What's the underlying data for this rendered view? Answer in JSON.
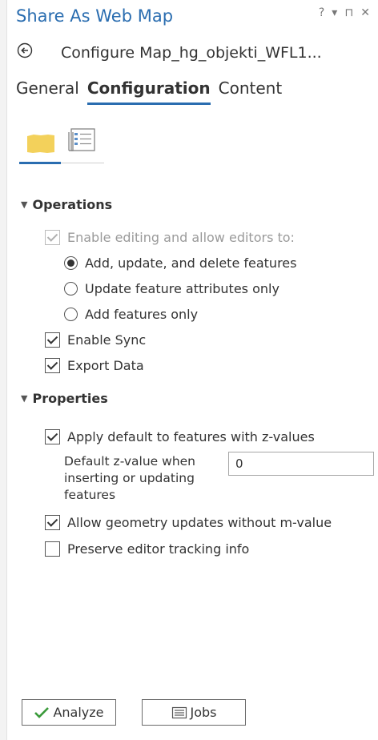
{
  "window": {
    "title": "Share As Web Map",
    "controls": {
      "help": "?",
      "dropdown": "▾",
      "pin": "⊓",
      "close": "✕"
    }
  },
  "header": {
    "subtitle": "Configure Map_hg_objekti_WFL1..."
  },
  "tabs": [
    {
      "label": "General",
      "active": false
    },
    {
      "label": "Configuration",
      "active": true
    },
    {
      "label": "Content",
      "active": false
    }
  ],
  "icon_tabs": [
    {
      "icon": "layer-folder-icon",
      "active": true
    },
    {
      "icon": "list-properties-icon",
      "active": false
    }
  ],
  "operations": {
    "header": "Operations",
    "enable_editing": {
      "label": "Enable editing and allow editors to:",
      "checked": true,
      "disabled": true
    },
    "options": [
      {
        "label": "Add, update, and delete features",
        "selected": true
      },
      {
        "label": "Update feature attributes only",
        "selected": false
      },
      {
        "label": "Add features only",
        "selected": false
      }
    ],
    "enable_sync": {
      "label": "Enable Sync",
      "checked": true
    },
    "export_data": {
      "label": "Export Data",
      "checked": true
    }
  },
  "properties": {
    "header": "Properties",
    "apply_default_z": {
      "label": "Apply default to features with z-values",
      "checked": true
    },
    "default_z": {
      "label": "Default z-value when inserting or updating features",
      "value": "0"
    },
    "allow_geometry_updates": {
      "label": "Allow geometry updates without m-value",
      "checked": true
    },
    "preserve_tracking": {
      "label": "Preserve editor tracking info",
      "checked": false
    }
  },
  "buttons": {
    "analyze": "Analyze",
    "jobs": "Jobs"
  },
  "colors": {
    "accent": "#2a6db0",
    "folder": "#f3d15b",
    "analyze_check": "#3a9a3a"
  }
}
